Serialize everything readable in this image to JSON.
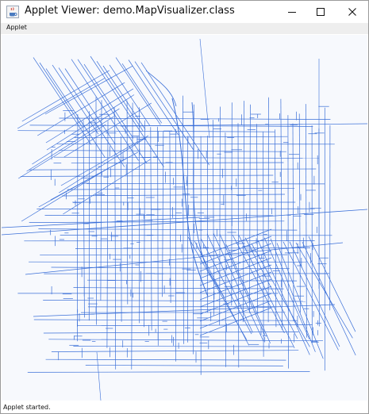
{
  "window": {
    "title": "Applet Viewer: demo.MapVisualizer.class",
    "app_icon": "java-coffee-cup-icon",
    "controls": [
      "minimize-icon",
      "maximize-icon",
      "close-icon"
    ]
  },
  "menubar": {
    "items": [
      {
        "label": "Applet"
      }
    ]
  },
  "map": {
    "description_icon": "street-map",
    "line_color": "#3a6fd8",
    "background_color": "#f7f9fd"
  },
  "status": {
    "text": "Applet started."
  }
}
